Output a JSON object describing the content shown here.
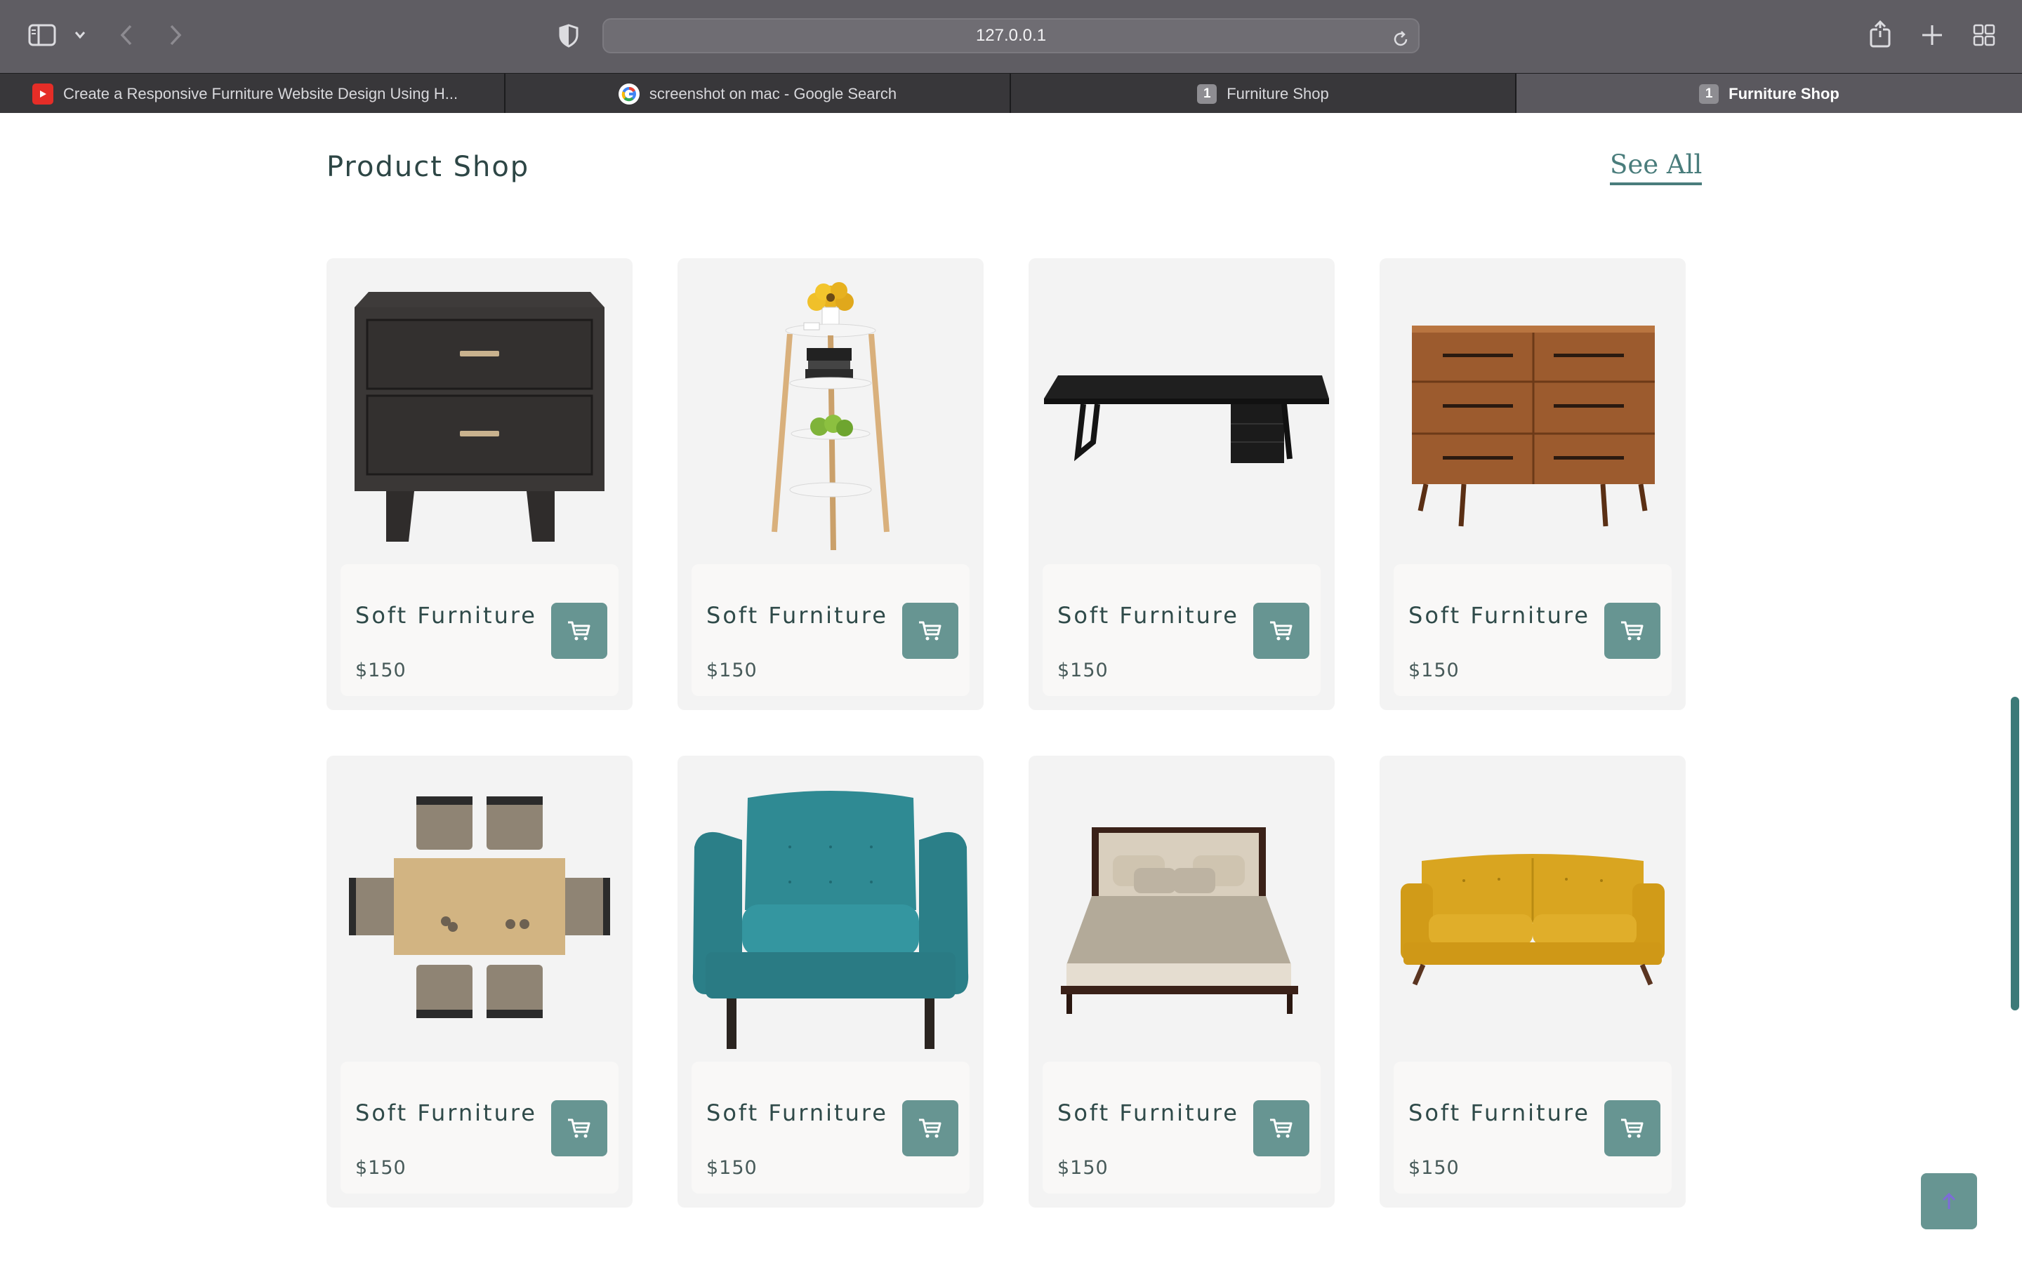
{
  "browser": {
    "url": "127.0.0.1",
    "tabs": [
      {
        "title": "Create a Responsive Furniture Website Design Using H...",
        "favicon": "youtube-icon",
        "active": false
      },
      {
        "title": "screenshot on mac - Google Search",
        "favicon": "google-icon",
        "active": false
      },
      {
        "title": "Furniture Shop",
        "favicon": "1",
        "active": false
      },
      {
        "title": "Furniture Shop",
        "favicon": "1",
        "active": true
      }
    ]
  },
  "section": {
    "title": "Product Shop",
    "see_all": "See All"
  },
  "products": [
    {
      "name": "Soft Furniture",
      "price": "$150",
      "image": "nightstand",
      "cart_icon": "cart-icon"
    },
    {
      "name": "Soft Furniture",
      "price": "$150",
      "image": "side-table",
      "cart_icon": "cart-icon"
    },
    {
      "name": "Soft Furniture",
      "price": "$150",
      "image": "desk",
      "cart_icon": "cart-icon"
    },
    {
      "name": "Soft Furniture",
      "price": "$150",
      "image": "dresser",
      "cart_icon": "cart-icon"
    },
    {
      "name": "Soft Furniture",
      "price": "$150",
      "image": "dining-set",
      "cart_icon": "cart-icon"
    },
    {
      "name": "Soft Furniture",
      "price": "$150",
      "image": "armchair",
      "cart_icon": "cart-icon"
    },
    {
      "name": "Soft Furniture",
      "price": "$150",
      "image": "bed",
      "cart_icon": "cart-icon"
    },
    {
      "name": "Soft Furniture",
      "price": "$150",
      "image": "sofa",
      "cart_icon": "cart-icon"
    }
  ],
  "colors": {
    "accent": "#679592",
    "title": "#2d4645",
    "link": "#4a7d7c",
    "card_bg": "#f3f3f3"
  }
}
